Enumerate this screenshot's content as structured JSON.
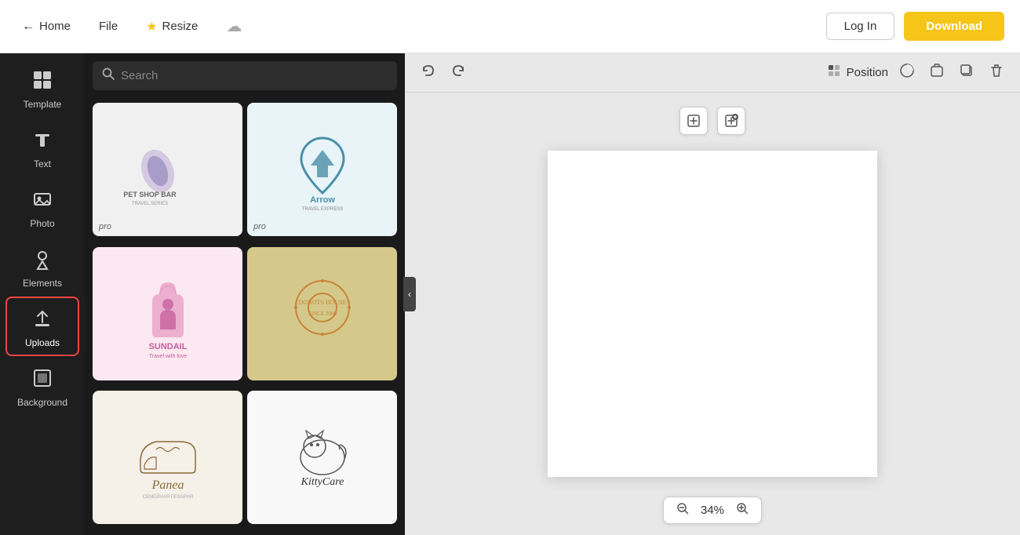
{
  "topbar": {
    "home_label": "Home",
    "file_label": "File",
    "resize_label": "Resize",
    "login_label": "Log In",
    "download_label": "Download"
  },
  "search": {
    "placeholder": "Search"
  },
  "sidebar": {
    "items": [
      {
        "id": "template",
        "label": "Template",
        "icon": "⊞"
      },
      {
        "id": "text",
        "label": "Text",
        "icon": "T"
      },
      {
        "id": "photo",
        "label": "Photo",
        "icon": "🖼"
      },
      {
        "id": "elements",
        "label": "Elements",
        "icon": "✦"
      },
      {
        "id": "uploads",
        "label": "Uploads",
        "icon": "⬇"
      },
      {
        "id": "background",
        "label": "Background",
        "icon": "▣"
      }
    ]
  },
  "templates": [
    {
      "id": "petshop",
      "name": "PET SHOP BAR",
      "badge": "pro",
      "bg": "#f0f0f0"
    },
    {
      "id": "arrow",
      "name": "Arrow",
      "badge": "pro",
      "bg": "#e8f4f8"
    },
    {
      "id": "sundail",
      "name": "SUNDAIL",
      "badge": "",
      "bg": "#fce8f0"
    },
    {
      "id": "donuts",
      "name": "DONUTS HOUSE",
      "badge": "",
      "bg": "#d4c98a"
    },
    {
      "id": "panea",
      "name": "Panea",
      "badge": "",
      "bg": "#f5f0e8"
    },
    {
      "id": "kittycare",
      "name": "KittyCare",
      "badge": "",
      "bg": "#f8f8f8"
    }
  ],
  "canvas": {
    "zoom_value": "34%",
    "position_label": "Position"
  }
}
